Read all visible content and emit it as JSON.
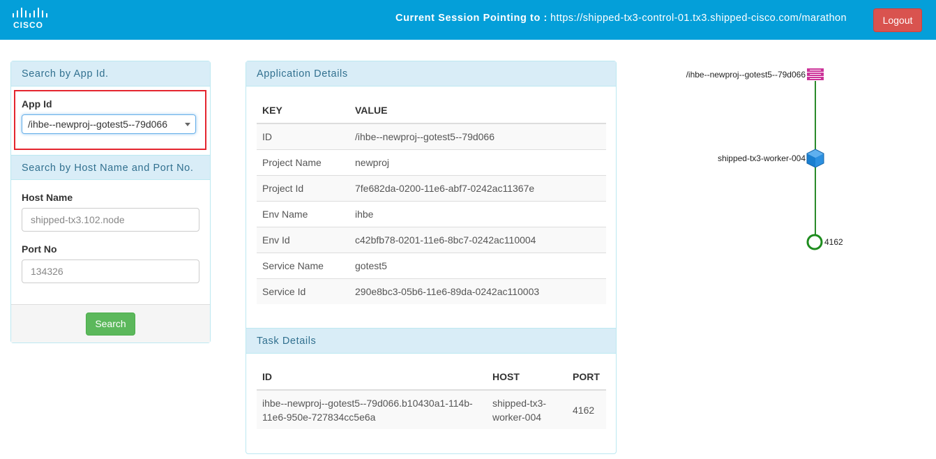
{
  "header": {
    "logo_text": "CISCO",
    "session_label": "Current Session Pointing to :",
    "session_url": "https://shipped-tx3-control-01.tx3.shipped-cisco.com/marathon",
    "logout_label": "Logout"
  },
  "search_panel": {
    "app_heading": "Search by App Id.",
    "app_id_label": "App Id",
    "app_id_value": "/ihbe--newproj--gotest5--79d066",
    "host_heading": "Search by Host Name and Port No.",
    "host_label": "Host Name",
    "host_placeholder": "shipped-tx3.102.node",
    "port_label": "Port No",
    "port_placeholder": "134326",
    "search_label": "Search"
  },
  "app_details": {
    "heading": "Application Details",
    "columns": [
      "KEY",
      "VALUE"
    ],
    "rows": [
      {
        "key": "ID",
        "value": "/ihbe--newproj--gotest5--79d066"
      },
      {
        "key": "Project Name",
        "value": "newproj"
      },
      {
        "key": "Project Id",
        "value": "7fe682da-0200-11e6-abf7-0242ac11367e"
      },
      {
        "key": "Env Name",
        "value": "ihbe"
      },
      {
        "key": "Env Id",
        "value": "c42bfb78-0201-11e6-8bc7-0242ac110004"
      },
      {
        "key": "Service Name",
        "value": "gotest5"
      },
      {
        "key": "Service Id",
        "value": "290e8bc3-05b6-11e6-89da-0242ac110003"
      }
    ]
  },
  "task_details": {
    "heading": "Task Details",
    "columns": [
      "ID",
      "HOST",
      "PORT"
    ],
    "rows": [
      {
        "id": "ihbe--newproj--gotest5--79d066.b10430a1-114b-11e6-950e-727834cc5e6a",
        "host": "shipped-tx3-worker-004",
        "port": "4162"
      }
    ]
  },
  "topology": {
    "app_node": "/ihbe--newproj--gotest5--79d066",
    "host_node": "shipped-tx3-worker-004",
    "port_node": "4162",
    "colors": {
      "link": "#2a8a2a",
      "app": "#cc3399",
      "host": "#1a7fd0",
      "port": "#1e8c1e"
    }
  },
  "colors": {
    "header": "#049fd9",
    "logout": "#d9534f",
    "search": "#5cb85c",
    "panel_head": "#d9edf7",
    "highlight": "#e4252e"
  }
}
